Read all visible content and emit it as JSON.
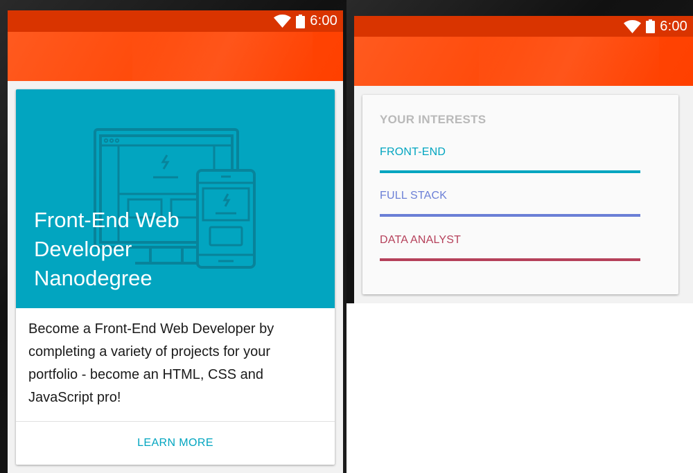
{
  "status_bar": {
    "time": "6:00",
    "icons": [
      "wifi-icon",
      "battery-icon"
    ]
  },
  "colors": {
    "status_bar": "#d93400",
    "toolbar": "#ff4a0a",
    "hero": "#02a5c0",
    "accent_teal": "#02a5c0",
    "front_end": "#02a5c0",
    "full_stack": "#6b7fd6",
    "data_analyst": "#b5405a"
  },
  "course_card": {
    "title": "Front-End Web Developer Nanodegree",
    "description": "Become a Front-End Web Developer by completing a variety of projects for your portfolio - become an HTML, CSS and JavaScript pro!",
    "action_label": "LEARN MORE",
    "illustration": "devices-illustration-icon"
  },
  "interests_card": {
    "title": "YOUR INTERESTS",
    "items": [
      {
        "label": "FRONT-END",
        "color": "#02a5c0"
      },
      {
        "label": "FULL STACK",
        "color": "#6b7fd6"
      },
      {
        "label": "DATA ANALYST",
        "color": "#b5405a"
      }
    ]
  }
}
